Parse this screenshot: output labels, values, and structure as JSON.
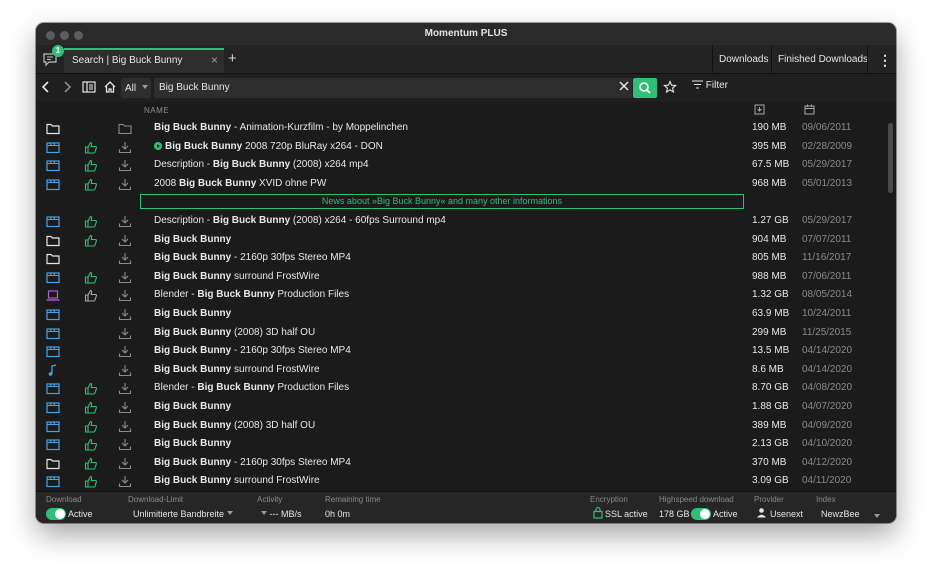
{
  "window": {
    "title": "Momentum PLUS"
  },
  "tabs": {
    "notification_badge": "1",
    "active_tab_label": "Search | Big Buck Bunny",
    "close_symbol": "×",
    "add_symbol": "+"
  },
  "top_buttons": {
    "downloads": "Downloads",
    "finished_downloads": "Finished Downloads",
    "menu": "⋮"
  },
  "toolbar": {
    "category_value": "All",
    "search_value": "Big Buck Bunny",
    "filter_label": "Filter"
  },
  "table": {
    "column_name_header": "NAME",
    "rows": [
      {
        "type": "folder",
        "thumb": "none",
        "dl": "folder",
        "segments": [
          {
            "t": "Big Buck Bunny",
            "b": true
          },
          {
            "t": " - Animation-Kurzfilm - by Moppelinchen",
            "b": false
          }
        ],
        "size": "190 MB",
        "date": "09/06/2011",
        "play": false
      },
      {
        "type": "video",
        "thumb": "up",
        "dl": "download",
        "segments": [
          {
            "t": "Big Buck Bunny",
            "b": true
          },
          {
            "t": " 2008 720p BluRay x264 - DON",
            "b": false
          }
        ],
        "size": "395 MB",
        "date": "02/28/2009",
        "play": true
      },
      {
        "type": "video",
        "thumb": "up",
        "dl": "download",
        "segments": [
          {
            "t": "Description - ",
            "b": false
          },
          {
            "t": "Big Buck Bunny",
            "b": true
          },
          {
            "t": " (2008) x264 mp4",
            "b": false
          }
        ],
        "size": "67.5 MB",
        "date": "05/29/2017",
        "play": false
      },
      {
        "type": "video",
        "thumb": "up",
        "dl": "download",
        "segments": [
          {
            "t": "2008 ",
            "b": false
          },
          {
            "t": "Big Buck Bunny",
            "b": true
          },
          {
            "t": " XVID ohne PW",
            "b": false
          }
        ],
        "size": "968 MB",
        "date": "05/01/2013",
        "play": false
      },
      {
        "news": true,
        "text": "News about »Big Buck Bunny« and many other informations"
      },
      {
        "type": "video",
        "thumb": "up",
        "dl": "download",
        "segments": [
          {
            "t": "Description - ",
            "b": false
          },
          {
            "t": "Big Buck Bunny",
            "b": true
          },
          {
            "t": " (2008) x264 - 60fps Surround mp4",
            "b": false
          }
        ],
        "size": "1.27 GB",
        "date": "05/29/2017",
        "play": false
      },
      {
        "type": "folder",
        "thumb": "up",
        "dl": "download",
        "segments": [
          {
            "t": "Big Buck Bunny",
            "b": true
          }
        ],
        "size": "904 MB",
        "date": "07/07/2011",
        "play": false
      },
      {
        "type": "folder",
        "thumb": "none",
        "dl": "download",
        "segments": [
          {
            "t": "Big Buck Bunny",
            "b": true
          },
          {
            "t": " - 2160p 30fps Stereo MP4",
            "b": false
          }
        ],
        "size": "805 MB",
        "date": "11/16/2017",
        "play": false
      },
      {
        "type": "video",
        "thumb": "up",
        "dl": "download",
        "segments": [
          {
            "t": "Big Buck Bunny",
            "b": true
          },
          {
            "t": " surround FrostWire",
            "b": false
          }
        ],
        "size": "988 MB",
        "date": "07/06/2011",
        "play": false
      },
      {
        "type": "laptop",
        "thumb": "up-gray",
        "dl": "download",
        "segments": [
          {
            "t": "Blender - ",
            "b": false
          },
          {
            "t": "Big Buck Bunny",
            "b": true
          },
          {
            "t": " Production Files",
            "b": false
          }
        ],
        "size": "1.32 GB",
        "date": "08/05/2014",
        "play": false
      },
      {
        "type": "video",
        "thumb": "none",
        "dl": "download",
        "segments": [
          {
            "t": "Big Buck Bunny",
            "b": true
          }
        ],
        "size": "63.9 MB",
        "date": "10/24/2011",
        "play": false
      },
      {
        "type": "video",
        "thumb": "none",
        "dl": "download",
        "segments": [
          {
            "t": "Big Buck Bunny",
            "b": true
          },
          {
            "t": " (2008) 3D half OU",
            "b": false
          }
        ],
        "size": "299 MB",
        "date": "11/25/2015",
        "play": false
      },
      {
        "type": "video",
        "thumb": "none",
        "dl": "download",
        "segments": [
          {
            "t": "Big Buck Bunny",
            "b": true
          },
          {
            "t": " - 2160p 30fps Stereo MP4",
            "b": false
          }
        ],
        "size": "13.5 MB",
        "date": "04/14/2020",
        "play": false
      },
      {
        "type": "music",
        "thumb": "none",
        "dl": "download",
        "segments": [
          {
            "t": "Big Buck Bunny",
            "b": true
          },
          {
            "t": " surround FrostWire",
            "b": false
          }
        ],
        "size": "8.6 MB",
        "date": "04/14/2020",
        "play": false
      },
      {
        "type": "video",
        "thumb": "up",
        "dl": "download",
        "segments": [
          {
            "t": "Blender - ",
            "b": false
          },
          {
            "t": "Big Buck Bunny",
            "b": true
          },
          {
            "t": " Production Files",
            "b": false
          }
        ],
        "size": "8.70 GB",
        "date": "04/08/2020",
        "play": false
      },
      {
        "type": "video",
        "thumb": "up",
        "dl": "download",
        "segments": [
          {
            "t": "Big Buck Bunny",
            "b": true
          }
        ],
        "size": "1.88 GB",
        "date": "04/07/2020",
        "play": false
      },
      {
        "type": "video",
        "thumb": "up",
        "dl": "download",
        "segments": [
          {
            "t": "Big Buck Bunny",
            "b": true
          },
          {
            "t": " (2008) 3D half OU",
            "b": false
          }
        ],
        "size": "389 MB",
        "date": "04/09/2020",
        "play": false
      },
      {
        "type": "video",
        "thumb": "up",
        "dl": "download",
        "segments": [
          {
            "t": "Big Buck Bunny",
            "b": true
          }
        ],
        "size": "2.13 GB",
        "date": "04/10/2020",
        "play": false
      },
      {
        "type": "folder",
        "thumb": "up",
        "dl": "download",
        "segments": [
          {
            "t": "Big Buck Bunny",
            "b": true
          },
          {
            "t": " - 2160p 30fps Stereo MP4",
            "b": false
          }
        ],
        "size": "370 MB",
        "date": "04/12/2020",
        "play": false
      },
      {
        "type": "video",
        "thumb": "up",
        "dl": "download",
        "segments": [
          {
            "t": "Big Buck Bunny",
            "b": true
          },
          {
            "t": " surround FrostWire",
            "b": false
          }
        ],
        "size": "3.09 GB",
        "date": "04/11/2020",
        "play": false
      }
    ]
  },
  "status": {
    "download_label": "Download",
    "download_value": "Active",
    "download_limit_label": "Download-Limit",
    "download_limit_value": "Unlimitierte Bandbreite",
    "activity_label": "Activity",
    "activity_value": "--- MB/s",
    "remaining_label": "Remaining time",
    "remaining_value": "0h 0m",
    "encryption_label": "Encryption",
    "encryption_value": "SSL active",
    "highspeed_label": "Highspeed download",
    "highspeed_amount": "178 GB",
    "highspeed_value": "Active",
    "provider_label": "Provider",
    "provider_value": "Usenext",
    "index_label": "Index",
    "index_value": "NewzBee"
  },
  "colors": {
    "accent": "#2fbf77",
    "icon_blue": "#4aa3df",
    "icon_purple": "#b05cd6",
    "background": "#1b1b1b"
  }
}
